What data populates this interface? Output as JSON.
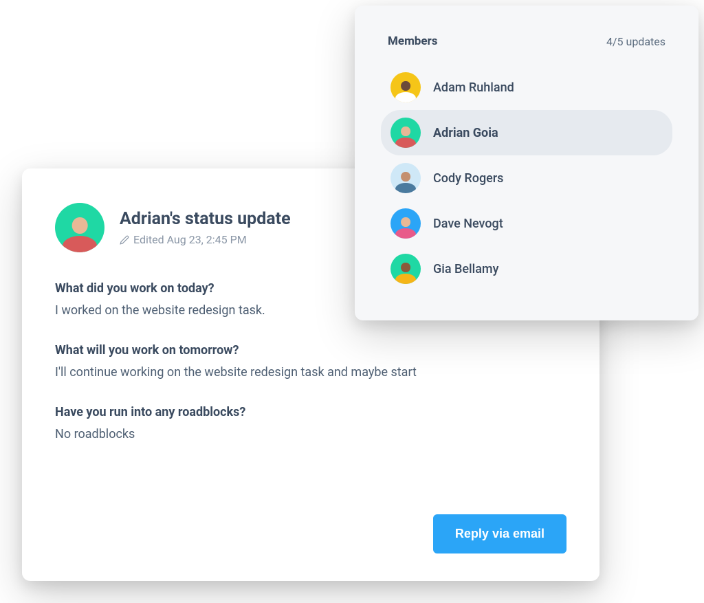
{
  "status": {
    "title": "Adrian's status update",
    "edited_text": "Edited Aug 23, 2:45 PM",
    "avatar_bg": "#1fd8a4",
    "qa": [
      {
        "question": "What did you work on today?",
        "answer": "I worked on the website redesign task."
      },
      {
        "question": "What will you work on tomorrow?",
        "answer": "I'll continue working on the website redesign task and maybe start"
      },
      {
        "question": "Have you run into any roadblocks?",
        "answer": "No roadblocks"
      }
    ],
    "reply_button_label": "Reply via email"
  },
  "members": {
    "title": "Members",
    "count_text": "4/5 updates",
    "items": [
      {
        "name": "Adam Ruhland",
        "avatar_bg": "#f5c518",
        "selected": false
      },
      {
        "name": "Adrian Goia",
        "avatar_bg": "#1fd8a4",
        "selected": true
      },
      {
        "name": "Cody Rogers",
        "avatar_bg": "#cfe8f7",
        "selected": false
      },
      {
        "name": "Dave Nevogt",
        "avatar_bg": "#2ba5f7",
        "selected": false
      },
      {
        "name": "Gia Bellamy",
        "avatar_bg": "#1fd8a4",
        "selected": false
      }
    ]
  }
}
